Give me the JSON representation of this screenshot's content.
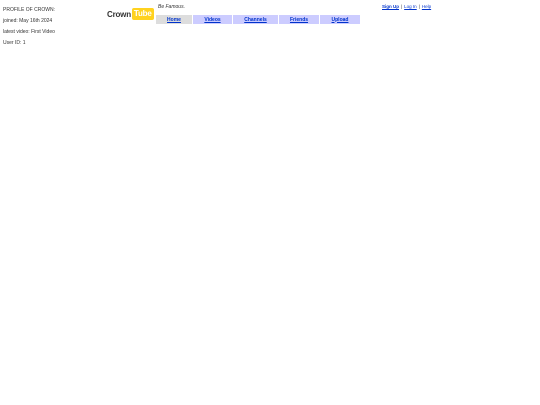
{
  "profile": {
    "title": "PROFILE OF CROWN:",
    "joined": "joined: May 16th 2024",
    "latest_video": "latest video: First Video",
    "user_id": "User ID: 1"
  },
  "logo": {
    "word": "Crown",
    "box_text": "Tube"
  },
  "slogan": "Be Famous.",
  "account": {
    "sign_up": "Sign Up",
    "log_in": "Log In",
    "help": "Help",
    "separator": "|"
  },
  "nav": {
    "tabs": [
      {
        "label": "Home"
      },
      {
        "label": "Videos"
      },
      {
        "label": "Channels"
      },
      {
        "label": "Friends"
      },
      {
        "label": "Upload"
      }
    ]
  },
  "colors": {
    "logo_accent": "#ffd21f",
    "link": "#0033cc",
    "tab_active": "#dddddd",
    "tab_inactive": "#ccccff"
  }
}
